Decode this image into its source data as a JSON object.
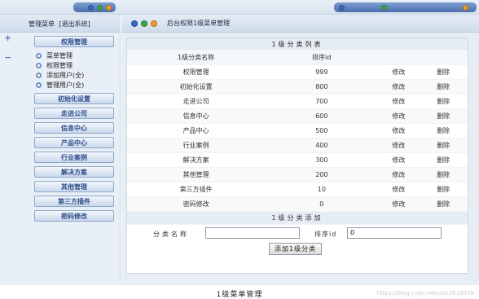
{
  "left_header": {
    "title": "管理菜单",
    "exit_link": "[退出系统]"
  },
  "main_header": {
    "breadcrumb": "后台权限1级菜单管理"
  },
  "menu": {
    "expand_symbol": "+",
    "collapse_symbol": "−",
    "sections": [
      {
        "label": "权限管理",
        "items": [
          "菜单管理",
          "权限管理",
          "添加用户(全)",
          "管理用户(全)"
        ]
      },
      {
        "label": "初始化设置",
        "items": []
      },
      {
        "label": "走进公司",
        "items": []
      },
      {
        "label": "信息中心",
        "items": []
      },
      {
        "label": "产品中心",
        "items": []
      },
      {
        "label": "行业案例",
        "items": []
      },
      {
        "label": "解决方案",
        "items": []
      },
      {
        "label": "其他管理",
        "items": []
      },
      {
        "label": "第三方插件",
        "items": []
      },
      {
        "label": "密码修改",
        "items": []
      }
    ]
  },
  "list_table": {
    "caption": "1级分类列表",
    "columns": {
      "name": "1级分类名称",
      "sort": "排序id"
    },
    "rows": [
      {
        "name": "权限管理",
        "sort": "999",
        "edit": "修改",
        "delete": "删除"
      },
      {
        "name": "初始化设置",
        "sort": "800",
        "edit": "修改",
        "delete": "删除"
      },
      {
        "name": "走进公司",
        "sort": "700",
        "edit": "修改",
        "delete": "删除"
      },
      {
        "name": "信息中心",
        "sort": "600",
        "edit": "修改",
        "delete": "删除"
      },
      {
        "name": "产品中心",
        "sort": "500",
        "edit": "修改",
        "delete": "删除"
      },
      {
        "name": "行业案例",
        "sort": "400",
        "edit": "修改",
        "delete": "删除"
      },
      {
        "name": "解决方案",
        "sort": "300",
        "edit": "修改",
        "delete": "删除"
      },
      {
        "name": "其他管理",
        "sort": "200",
        "edit": "修改",
        "delete": "删除"
      },
      {
        "name": "第三方插件",
        "sort": "10",
        "edit": "修改",
        "delete": "删除"
      },
      {
        "name": "密码修改",
        "sort": "0",
        "edit": "修改",
        "delete": "删除"
      }
    ]
  },
  "add_form": {
    "caption": "1级分类添加",
    "name_label": "分类名称",
    "name_value": "",
    "sort_label": "排序id",
    "sort_value": "0",
    "submit_label": "添加1级分类"
  },
  "figure_caption": "1级菜单管理",
  "watermark": "https://blog.csdn.net/u013618079"
}
